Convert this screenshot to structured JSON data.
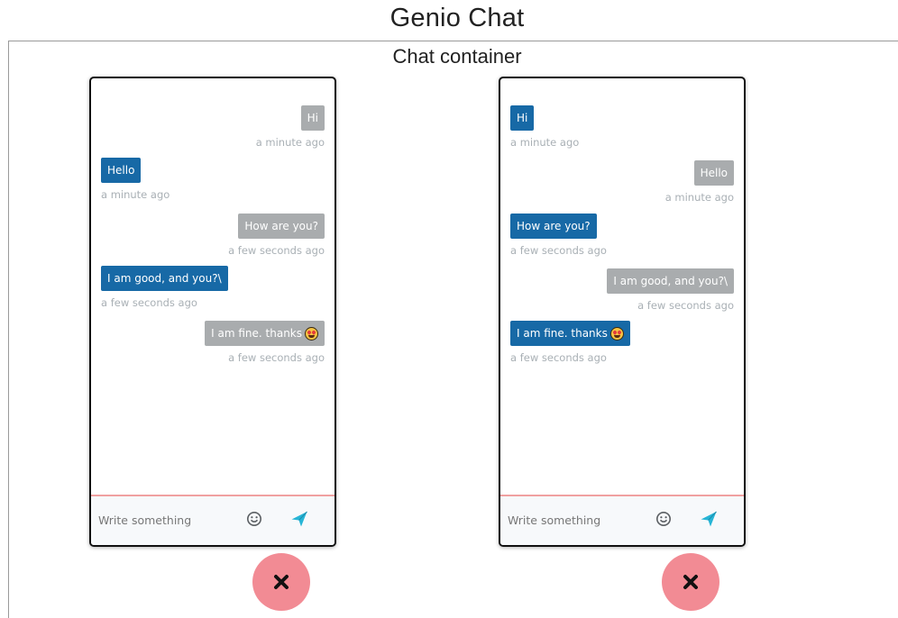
{
  "page": {
    "title": "Genio Chat",
    "container_title": "Chat container"
  },
  "colors": {
    "outgoing_bubble": "#a9acae",
    "incoming_bubble": "#1769a6",
    "close_button": "#f28b94",
    "send_icon": "#27b5d6"
  },
  "chats": [
    {
      "messages": [
        {
          "text": "Hi",
          "time": "a minute ago",
          "side": "right"
        },
        {
          "text": "Hello",
          "time": "a minute ago",
          "side": "left"
        },
        {
          "text": "How are you?",
          "time": "a few seconds ago",
          "side": "right"
        },
        {
          "text": "I am good, and you?\\",
          "time": "a few seconds ago",
          "side": "left"
        },
        {
          "text": "I am fine. thanks",
          "emoji": "heart-eyes-emoji",
          "time": "a few seconds ago",
          "side": "right"
        }
      ],
      "input": {
        "placeholder": "Write something",
        "value": ""
      },
      "icons": {
        "emoji": "smile-icon",
        "send": "send-icon",
        "close": "close-icon"
      }
    },
    {
      "messages": [
        {
          "text": "Hi",
          "time": "a minute ago",
          "side": "left"
        },
        {
          "text": "Hello",
          "time": "a minute ago",
          "side": "right"
        },
        {
          "text": "How are you?",
          "time": "a few seconds ago",
          "side": "left"
        },
        {
          "text": "I am good, and you?\\",
          "time": "a few seconds ago",
          "side": "right"
        },
        {
          "text": "I am fine. thanks",
          "emoji": "heart-eyes-emoji",
          "time": "a few seconds ago",
          "side": "left"
        }
      ],
      "input": {
        "placeholder": "Write something",
        "value": ""
      },
      "icons": {
        "emoji": "smile-icon",
        "send": "send-icon",
        "close": "close-icon"
      }
    }
  ]
}
